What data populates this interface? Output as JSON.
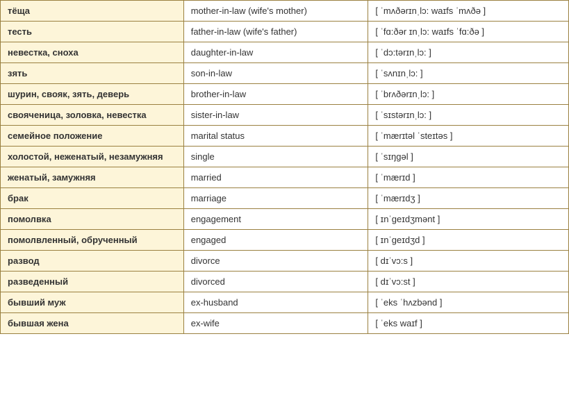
{
  "rows": [
    {
      "russian": "тёща",
      "english": "mother-in-law (wife's mother)",
      "phonetic": "[ ˈmʌðərɪnˌlɔ: waɪfs ˈmʌðə ]"
    },
    {
      "russian": "тесть",
      "english": "father-in-law (wife's father)",
      "phonetic": "[ ˈfɑ:ðər ɪnˌlɔ: waɪfs ˈfɑ:ðə ]"
    },
    {
      "russian": "невестка, сноха",
      "english": "daughter-in-law",
      "phonetic": "[ ˈdɔ:tərɪnˌlɔ: ]"
    },
    {
      "russian": "зять",
      "english": "son-in-law",
      "phonetic": "[ ˈsʌnɪnˌlɔ: ]"
    },
    {
      "russian": "шурин, свояк, зять, деверь",
      "english": "brother-in-law",
      "phonetic": "[ ˈbrʌðərɪnˌlɔ: ]"
    },
    {
      "russian": "свояченица, золовка, невестка",
      "english": "sister-in-law",
      "phonetic": "[ ˈsɪstərɪnˌlɔ: ]"
    },
    {
      "russian": "семейное положение",
      "english": "marital status",
      "phonetic": "[ ˈmærɪtəl ˈsteɪtəs ]"
    },
    {
      "russian": "холостой, неженатый, незамужняя",
      "english": "single",
      "phonetic": "[ ˈsɪŋgəl ]"
    },
    {
      "russian": "женатый, замужняя",
      "english": "married",
      "phonetic": "[ ˈmærɪd ]"
    },
    {
      "russian": "брак",
      "english": "marriage",
      "phonetic": "[ ˈmærɪdʒ ]"
    },
    {
      "russian": "помолвка",
      "english": "engagement",
      "phonetic": "[ ɪnˈgeɪdʒmənt ]"
    },
    {
      "russian": "помолвленный, обрученный",
      "english": "engaged",
      "phonetic": "[ ɪnˈgeɪdʒd ]"
    },
    {
      "russian": "развод",
      "english": "divorce",
      "phonetic": "[ dɪˈvɔ:s ]"
    },
    {
      "russian": "разведенный",
      "english": "divorced",
      "phonetic": "[ dɪˈvɔ:st ]"
    },
    {
      "russian": "бывший муж",
      "english": "ex-husband",
      "phonetic": "[ ˈeks ˈhʌzbənd ]"
    },
    {
      "russian": "бывшая жена",
      "english": "ex-wife",
      "phonetic": "[ ˈeks waɪf ]"
    }
  ]
}
